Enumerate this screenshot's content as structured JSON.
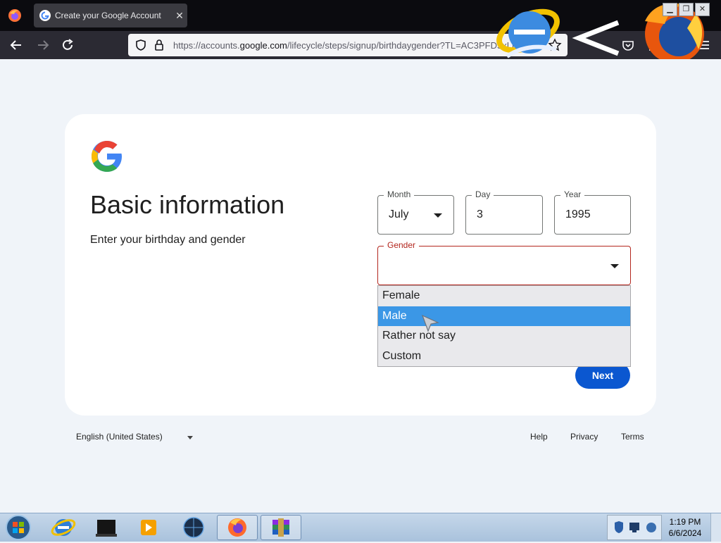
{
  "browser": {
    "tab_title": "Create your Google Account",
    "url_prefix": "https://accounts.",
    "url_domain": "google.com",
    "url_suffix": "/lifecycle/steps/signup/birthdaygender?TL=AC3PFD5xLFd"
  },
  "page": {
    "heading": "Basic information",
    "subheading": "Enter your birthday and gender"
  },
  "form": {
    "month": {
      "label": "Month",
      "value": "July"
    },
    "day": {
      "label": "Day",
      "value": "3"
    },
    "year": {
      "label": "Year",
      "value": "1995"
    },
    "gender": {
      "label": "Gender",
      "value": ""
    },
    "gender_options": [
      "Female",
      "Male",
      "Rather not say",
      "Custom"
    ],
    "highlighted_option": "Male",
    "next_label": "Next"
  },
  "footer": {
    "language": "English (United States)",
    "links": [
      "Help",
      "Privacy",
      "Terms"
    ]
  },
  "taskbar": {
    "time": "1:19 PM",
    "date": "6/6/2024"
  },
  "colors": {
    "primary": "#0b57d0",
    "error": "#b3261e",
    "highlight": "#3b97e6",
    "page_bg": "#f0f4f9"
  }
}
